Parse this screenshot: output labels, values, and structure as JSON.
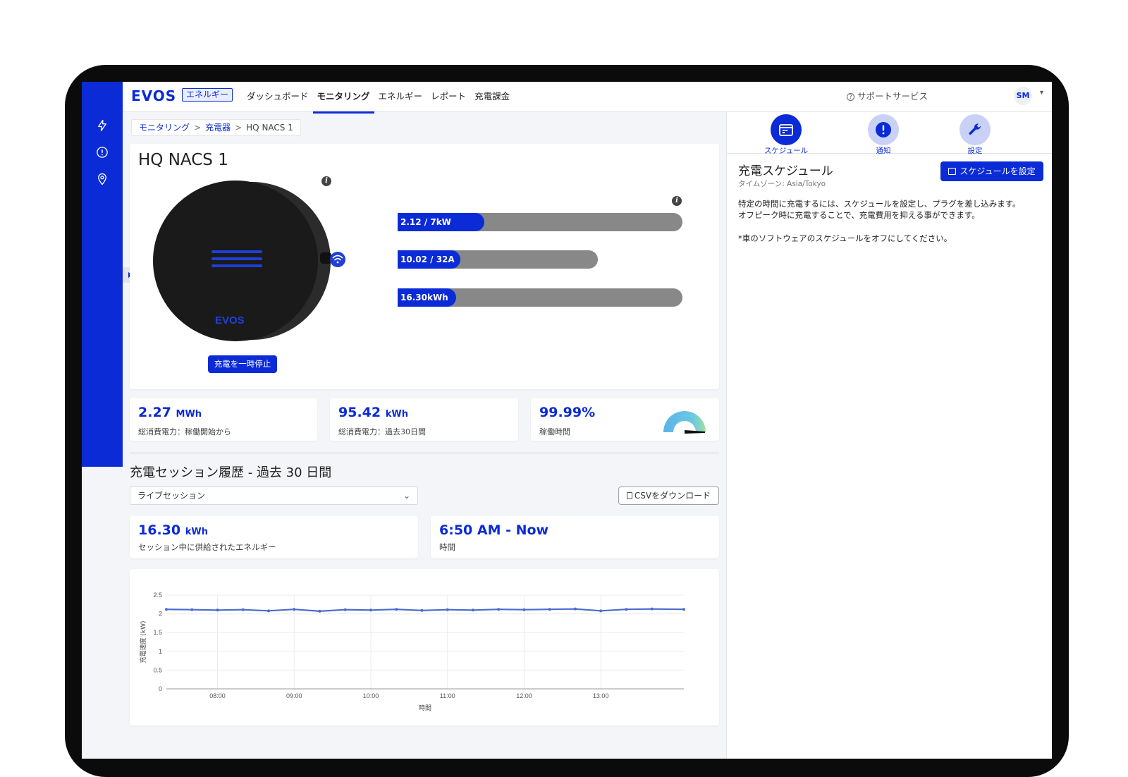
{
  "app": {
    "brand": "EVOS",
    "brand_tag": "エネルギー"
  },
  "nav": {
    "items": [
      {
        "label": "ダッシュボード"
      },
      {
        "label": "モニタリング"
      },
      {
        "label": "エネルギー"
      },
      {
        "label": "レポート"
      },
      {
        "label": "充電課金"
      }
    ],
    "active": "モニタリング",
    "support": "サポートサービス",
    "user_initials": "SM"
  },
  "sidebar": {
    "icons": [
      "lightning-icon",
      "alert-circle-icon",
      "location-pin-icon"
    ]
  },
  "breadcrumb": {
    "items": [
      "モニタリング",
      "充電器",
      "HQ NACS 1"
    ],
    "separator": ">"
  },
  "charger": {
    "name": "HQ NACS 1",
    "logo_text": "EVOS",
    "pause_button": "充電を一時停止",
    "meters": [
      {
        "label": "2.12 / 7kW",
        "value": 2.12,
        "max": 7,
        "unit": "kW"
      },
      {
        "label": "10.02 / 32A",
        "value": 10.02,
        "max": 32,
        "unit": "A"
      },
      {
        "label": "16.30kWh",
        "value": 16.3,
        "unit": "kWh"
      }
    ]
  },
  "stats": [
    {
      "value": "2.27",
      "unit": "MWh",
      "label": "総消費電力：稼働開始から"
    },
    {
      "value": "95.42",
      "unit": "kWh",
      "label": "総消費電力：過去30日間"
    },
    {
      "value": "99.99%",
      "unit": "",
      "label": "稼働時間",
      "gauge_fraction": 0.9999
    }
  ],
  "history": {
    "title": "充電セッション履歴 - 過去 30 日間",
    "select_value": "ライブセッション",
    "csv_button": "CSVをダウンロード",
    "energy_value": "16.30",
    "energy_unit": "kWh",
    "energy_label": "セッション中に供給されたエネルギー",
    "time_value": "6:50 AM - Now",
    "time_label": "時間"
  },
  "chart_data": {
    "type": "line",
    "xlabel": "時間",
    "ylabel": "充電速度 (kW)",
    "ylim": [
      0,
      2.5
    ],
    "yticks": [
      0,
      0.5,
      1,
      1.5,
      2,
      2.5
    ],
    "xticks": [
      "08:00",
      "09:00",
      "10:00",
      "11:00",
      "12:00",
      "13:00"
    ],
    "x_range": [
      "07:20",
      "14:05"
    ],
    "grid": true,
    "series": [
      {
        "color": "#4a6bd0",
        "x": [
          "07:20",
          "07:40",
          "08:00",
          "08:20",
          "08:40",
          "09:00",
          "09:20",
          "09:40",
          "10:00",
          "10:20",
          "10:40",
          "11:00",
          "11:20",
          "11:40",
          "12:00",
          "12:20",
          "12:40",
          "13:00",
          "13:20",
          "13:40",
          "14:05"
        ],
        "values": [
          2.12,
          2.11,
          2.1,
          2.11,
          2.08,
          2.12,
          2.07,
          2.11,
          2.1,
          2.12,
          2.09,
          2.11,
          2.1,
          2.12,
          2.11,
          2.12,
          2.13,
          2.08,
          2.12,
          2.13,
          2.12
        ]
      }
    ]
  },
  "schedule_panel": {
    "tabs": [
      {
        "label": "スケジュール",
        "icon": "calendar-icon"
      },
      {
        "label": "通知",
        "icon": "alert-icon"
      },
      {
        "label": "設定",
        "icon": "wrench-icon"
      }
    ],
    "title": "充電スケジュール",
    "timezone": "タイムゾーン: Asia/Tokyo",
    "set_button": "スケジュールを設定",
    "description": "特定の時間に充電するには、スケジュールを設定し、プラグを差し込みます。オフピーク時に充電することで、充電費用を抑える事ができます。",
    "note": "*車のソフトウェアのスケジュールをオフにしてください。"
  },
  "colors": {
    "brand": "#0b2bd6",
    "bar_track": "#888888",
    "gauge_arc": "#5ab4e8",
    "gauge_end": "#9fe0a0"
  }
}
